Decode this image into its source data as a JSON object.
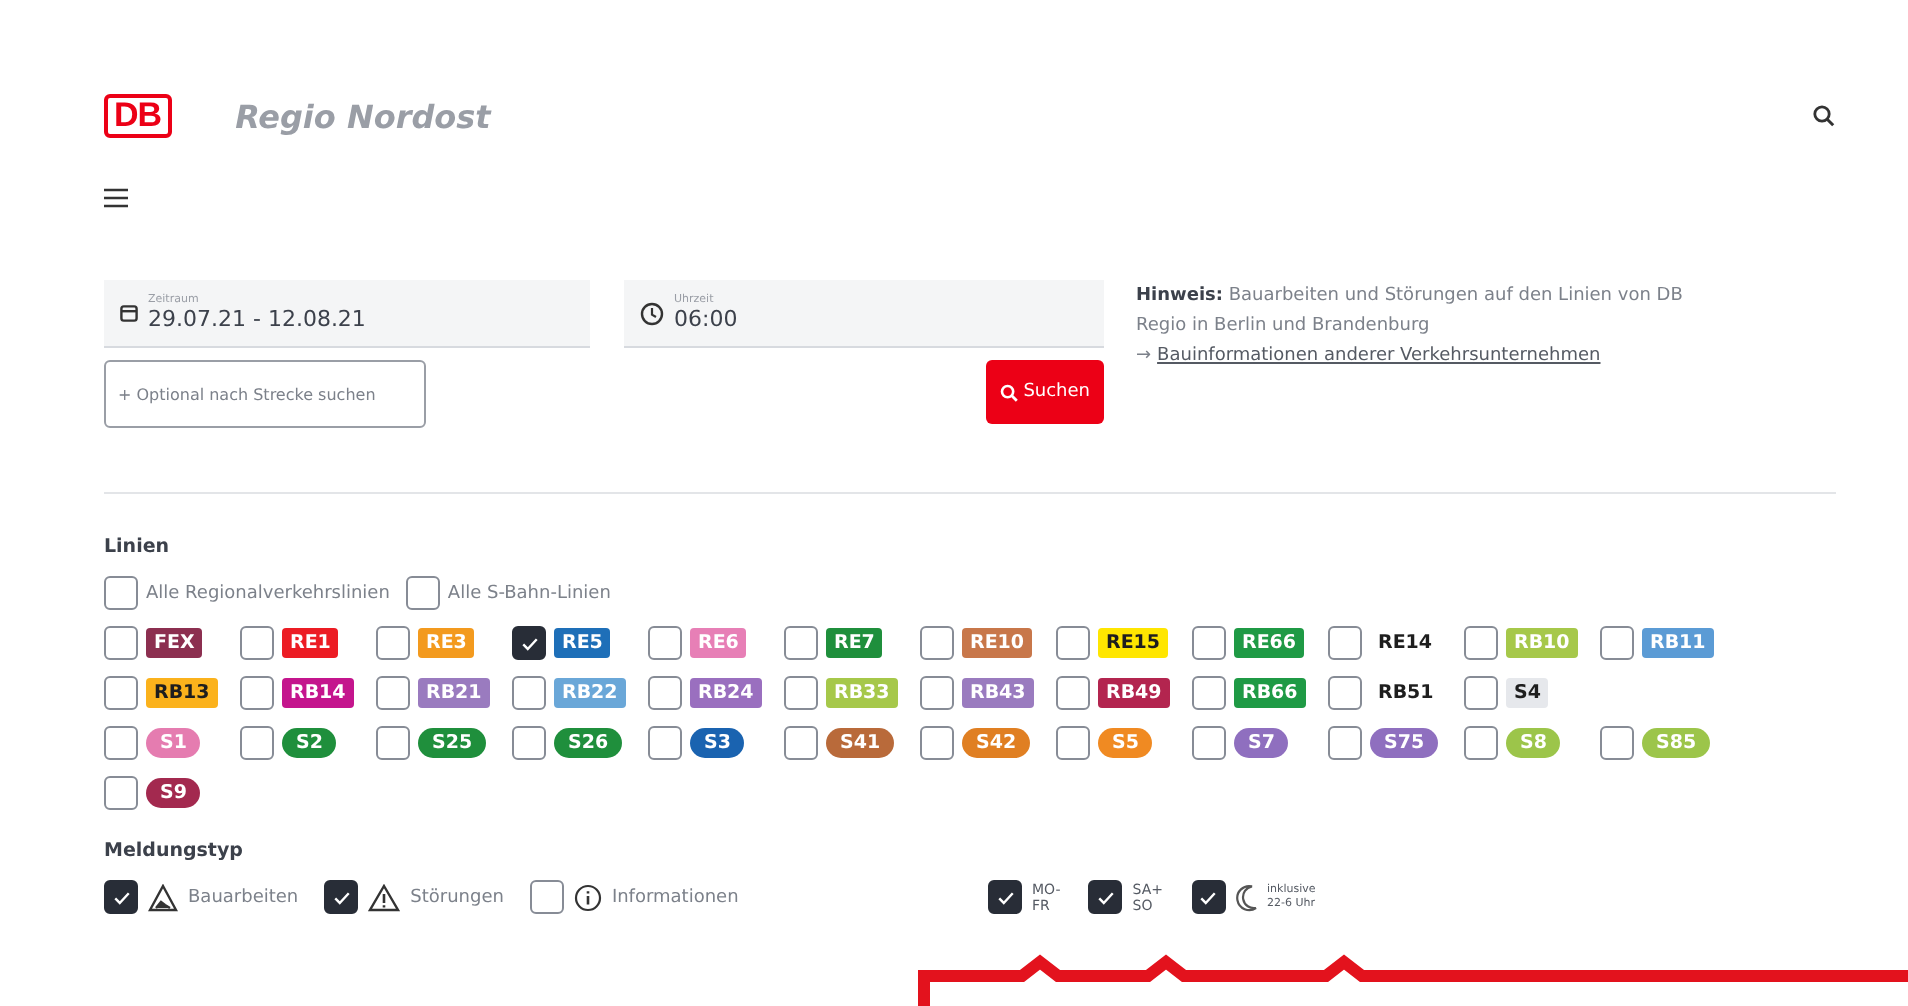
{
  "header": {
    "logo": "DB",
    "title": "Regio Nordost"
  },
  "search": {
    "date": {
      "label": "Zeitraum",
      "value": "29.07.21 - 12.08.21"
    },
    "time": {
      "label": "Uhrzeit",
      "value": "06:00"
    },
    "route": {
      "placeholder": "+ Optional nach Strecke suchen"
    },
    "button": "Suchen",
    "notice": {
      "text": "**Hinweis:** Bauarbeiten und Störungen auf den Linien von DB Regio in Berlin und Brandenburg",
      "arrow": "→",
      "link": "Bauinformationen anderer Verkehrsunternehmen"
    }
  },
  "lines": {
    "heading": "Linien",
    "groups": [
      {
        "label": "Alle Regionalverkehrslinien",
        "checked": false
      },
      {
        "label": "Alle S-Bahn-Linien",
        "checked": false
      }
    ],
    "rows": [
      [
        {
          "label": "FEX",
          "kind": "rect",
          "color": "#8c2f50",
          "checked": false
        },
        {
          "label": "RE1",
          "kind": "rect",
          "color": "#ec1c24",
          "checked": false
        },
        {
          "label": "RE3",
          "kind": "rect",
          "color": "#f39a1e",
          "checked": false
        },
        {
          "label": "RE5",
          "kind": "rect",
          "color": "#1e6fb8",
          "checked": true
        },
        {
          "label": "RE6",
          "kind": "rect",
          "color": "#e77fb6",
          "checked": false
        },
        {
          "label": "RE7",
          "kind": "rect",
          "color": "#1f8f3c",
          "checked": false
        },
        {
          "label": "RE10",
          "kind": "rect",
          "color": "#c8774a",
          "checked": false
        },
        {
          "label": "RE15",
          "kind": "rect",
          "color": "#ffe600",
          "checked": false
        },
        {
          "label": "RE66",
          "kind": "rect",
          "color": "#1f9a45",
          "checked": false
        },
        {
          "label": "RE14",
          "kind": "plain",
          "checked": false
        },
        {
          "label": "RB10",
          "kind": "rect",
          "color": "#a6c84a",
          "checked": false
        },
        {
          "label": "RB11",
          "kind": "rect",
          "color": "#5b9bd5",
          "checked": false
        }
      ],
      [
        {
          "label": "RB13",
          "kind": "rect",
          "color": "#fbb21c",
          "checked": false
        },
        {
          "label": "RB14",
          "kind": "rect",
          "color": "#c4158d",
          "checked": false
        },
        {
          "label": "RB21",
          "kind": "rect",
          "color": "#9a7bbf",
          "checked": false
        },
        {
          "label": "RB22",
          "kind": "rect",
          "color": "#6aa7d8",
          "checked": false
        },
        {
          "label": "RB24",
          "kind": "rect",
          "color": "#9a6fbf",
          "checked": false
        },
        {
          "label": "RB33",
          "kind": "rect",
          "color": "#a6c84a",
          "checked": false
        },
        {
          "label": "RB43",
          "kind": "rect",
          "color": "#9a7bbf",
          "checked": false
        },
        {
          "label": "RB49",
          "kind": "rect",
          "color": "#b3254f",
          "checked": false
        },
        {
          "label": "RB66",
          "kind": "rect",
          "color": "#1f9a45",
          "checked": false
        },
        {
          "label": "RB51",
          "kind": "plain",
          "checked": false
        },
        {
          "label": "S4",
          "kind": "rect",
          "color": "#e6e8ec",
          "checked": false
        }
      ],
      [
        {
          "label": "S1",
          "kind": "pill",
          "color": "#e57cb0",
          "checked": false
        },
        {
          "label": "S2",
          "kind": "pill",
          "color": "#1f8f3c",
          "checked": false
        },
        {
          "label": "S25",
          "kind": "pill",
          "color": "#1f8f3c",
          "checked": false
        },
        {
          "label": "S26",
          "kind": "pill",
          "color": "#1f8f3c",
          "checked": false
        },
        {
          "label": "S3",
          "kind": "pill",
          "color": "#1a63b0",
          "checked": false
        },
        {
          "label": "S41",
          "kind": "pill",
          "color": "#b96a3a",
          "checked": false
        },
        {
          "label": "S42",
          "kind": "pill",
          "color": "#e07f22",
          "checked": false
        },
        {
          "label": "S5",
          "kind": "pill",
          "color": "#f08a22",
          "checked": false
        },
        {
          "label": "S7",
          "kind": "pill",
          "color": "#8f6fbf",
          "checked": false
        },
        {
          "label": "S75",
          "kind": "pill",
          "color": "#8f6fbf",
          "checked": false
        },
        {
          "label": "S8",
          "kind": "pill",
          "color": "#9cc54a",
          "checked": false
        },
        {
          "label": "S85",
          "kind": "pill",
          "color": "#9cc54a",
          "checked": false
        }
      ],
      [
        {
          "label": "S9",
          "kind": "pill",
          "color": "#a3294f",
          "checked": false
        }
      ]
    ]
  },
  "message_types": {
    "heading": "Meldungstyp",
    "items": [
      {
        "label": "Bauarbeiten",
        "kind": "construction",
        "checked": true
      },
      {
        "label": "Störungen",
        "kind": "warning",
        "checked": true
      },
      {
        "label": "Informationen",
        "kind": "info",
        "checked": false
      }
    ]
  },
  "days": [
    {
      "kind": "plain",
      "lines": [
        "MO-",
        "FR"
      ],
      "checked": true
    },
    {
      "kind": "plain",
      "lines": [
        "SA+",
        "SO"
      ],
      "checked": true
    },
    {
      "kind": "night",
      "lines": [
        "inklusive",
        "22-6 Uhr"
      ],
      "checked": true
    }
  ]
}
